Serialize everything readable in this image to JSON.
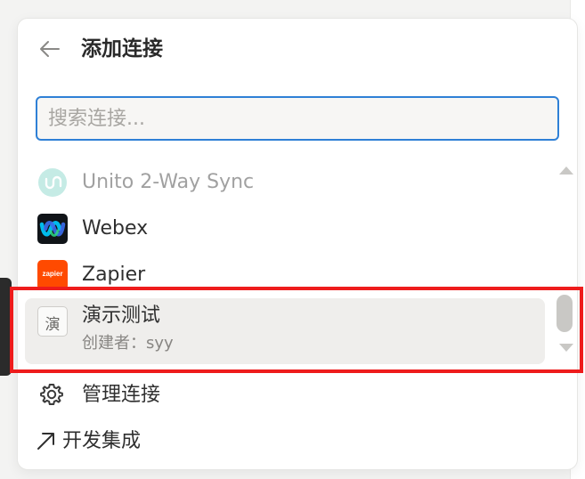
{
  "dialog": {
    "title": "添加连接",
    "search_placeholder": "搜索连接..."
  },
  "connections": [
    {
      "name": "Unito 2-Way Sync",
      "icon": "unito-logo-icon",
      "faded": true
    },
    {
      "name": "Webex",
      "icon": "webex-logo-icon"
    },
    {
      "name": "Zapier",
      "icon": "zapier-logo-icon",
      "icon_text": "zapier"
    },
    {
      "name": "演示测试",
      "subtitle": "创建者：syy",
      "icon": "demo-test-icon",
      "icon_text": "演",
      "selected": true
    }
  ],
  "footer": {
    "manage_label": "管理连接",
    "develop_label": "开发集成"
  },
  "colors": {
    "accent_border": "#2f80d6",
    "highlight": "#ee1c1c",
    "zapier": "#ff4a00",
    "unito": "#7fd3c7"
  }
}
